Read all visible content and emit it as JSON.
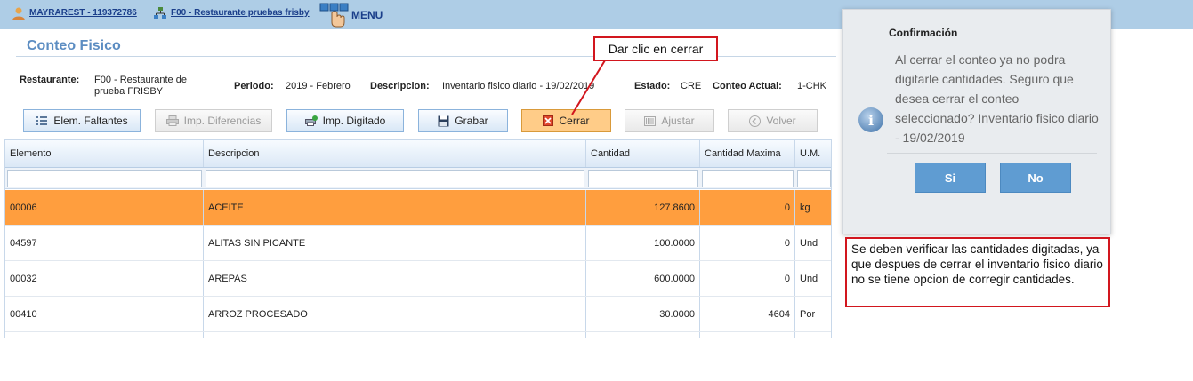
{
  "topbar": {
    "user_link": "MAYRAREST - 119372786",
    "restaurant_link": "F00 - Restaurante pruebas frisby",
    "menu_link": "MENU"
  },
  "page": {
    "title": "Conteo Fisico"
  },
  "info": {
    "restaurante_label": "Restaurante:",
    "restaurante_value_line1": "F00 - Restaurante de",
    "restaurante_value_line2": "prueba FRISBY",
    "periodo_label": "Periodo:",
    "periodo_value": "2019 - Febrero",
    "descripcion_label": "Descripcion:",
    "descripcion_value": "Inventario fisico diario - 19/02/2019",
    "estado_label": "Estado:",
    "estado_value": "CRE",
    "conteo_label": "Conteo Actual:",
    "conteo_value": "1-CHK"
  },
  "toolbar": {
    "faltantes": "Elem. Faltantes",
    "diferencias": "Imp. Diferencias",
    "digitado": "Imp. Digitado",
    "grabar": "Grabar",
    "cerrar": "Cerrar",
    "ajustar": "Ajustar",
    "volver": "Volver"
  },
  "callout": "Dar clic en cerrar",
  "grid": {
    "columns": [
      "Elemento",
      "Descripcion",
      "Cantidad",
      "Cantidad Maxima",
      "U.M."
    ],
    "rows": [
      {
        "elemento": "00006",
        "descripcion": "ACEITE",
        "cantidad": "127.8600",
        "maxima": "0",
        "um": "kg"
      },
      {
        "elemento": "04597",
        "descripcion": "ALITAS SIN PICANTE",
        "cantidad": "100.0000",
        "maxima": "0",
        "um": "Und"
      },
      {
        "elemento": "00032",
        "descripcion": "AREPAS",
        "cantidad": "600.0000",
        "maxima": "0",
        "um": "Und"
      },
      {
        "elemento": "00410",
        "descripcion": "ARROZ PROCESADO",
        "cantidad": "30.0000",
        "maxima": "4604",
        "um": "Por"
      }
    ]
  },
  "dialog": {
    "title": "Confirmación",
    "message": "Al cerrar el conteo ya no podra digitarle cantidades. Seguro que desea cerrar el conteo seleccionado? Inventario fisico diario - 19/02/2019",
    "yes": "Si",
    "no": "No"
  },
  "note": "Se deben verificar las cantidades digitadas, ya que despues de cerrar el inventario fisico diario no se tiene opcion de corregir cantidades.",
  "colors": {
    "topbar": "#aecde6",
    "selected_row": "#ff9e3e",
    "dialog_button": "#5f9cd2",
    "callout_border": "#d2161e"
  },
  "icons": [
    "user-icon",
    "network-icon",
    "menu-hand-icon",
    "list-icon",
    "print-icon",
    "print-check-icon",
    "save-icon",
    "close-x-icon",
    "barcode-icon",
    "back-icon",
    "info-icon"
  ]
}
